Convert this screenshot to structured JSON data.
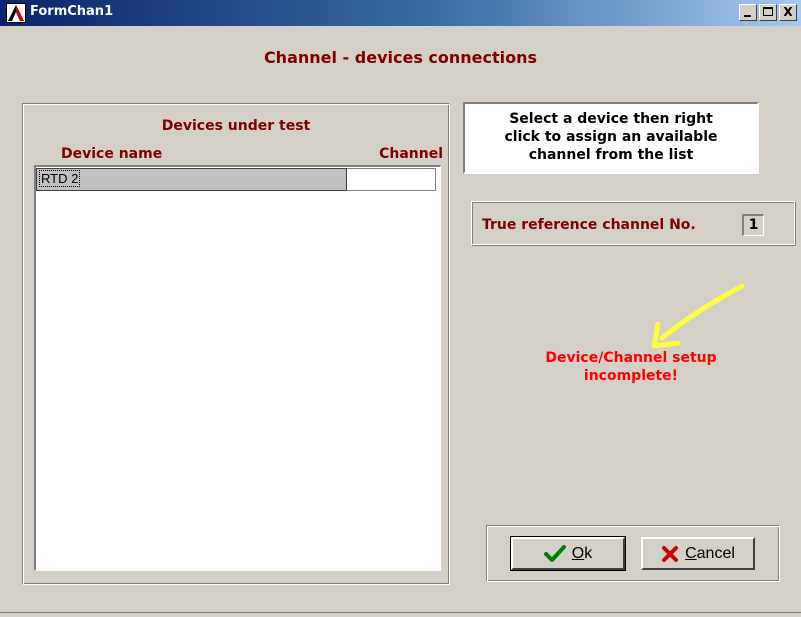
{
  "window": {
    "title": "FormChan1"
  },
  "title_buttons": {
    "minimize": "_",
    "maximize": "□",
    "close": "X"
  },
  "heading": "Channel - devices connections",
  "devices": {
    "group_title": "Devices under test",
    "col_device": "Device name",
    "col_channel": "Channel",
    "rows": [
      {
        "device": "RTD 2",
        "channel": ""
      }
    ]
  },
  "info": {
    "line1": "Select a device then right",
    "line2": "click to assign an available",
    "line3": "channel from the list"
  },
  "reference": {
    "label": "True reference channel  No.",
    "value": "1"
  },
  "warning": {
    "line1": "Device/Channel setup",
    "line2": "incomplete!"
  },
  "buttons": {
    "ok_first": "O",
    "ok_rest": "k",
    "cancel_first": "C",
    "cancel_rest": "ancel"
  },
  "colors": {
    "heading": "#800000",
    "warning": "#ff0000",
    "arrow": "#ffff40",
    "face": "#d4d0c8"
  },
  "icons": [
    "app-icon",
    "check-icon",
    "x-icon",
    "arrow-icon"
  ]
}
